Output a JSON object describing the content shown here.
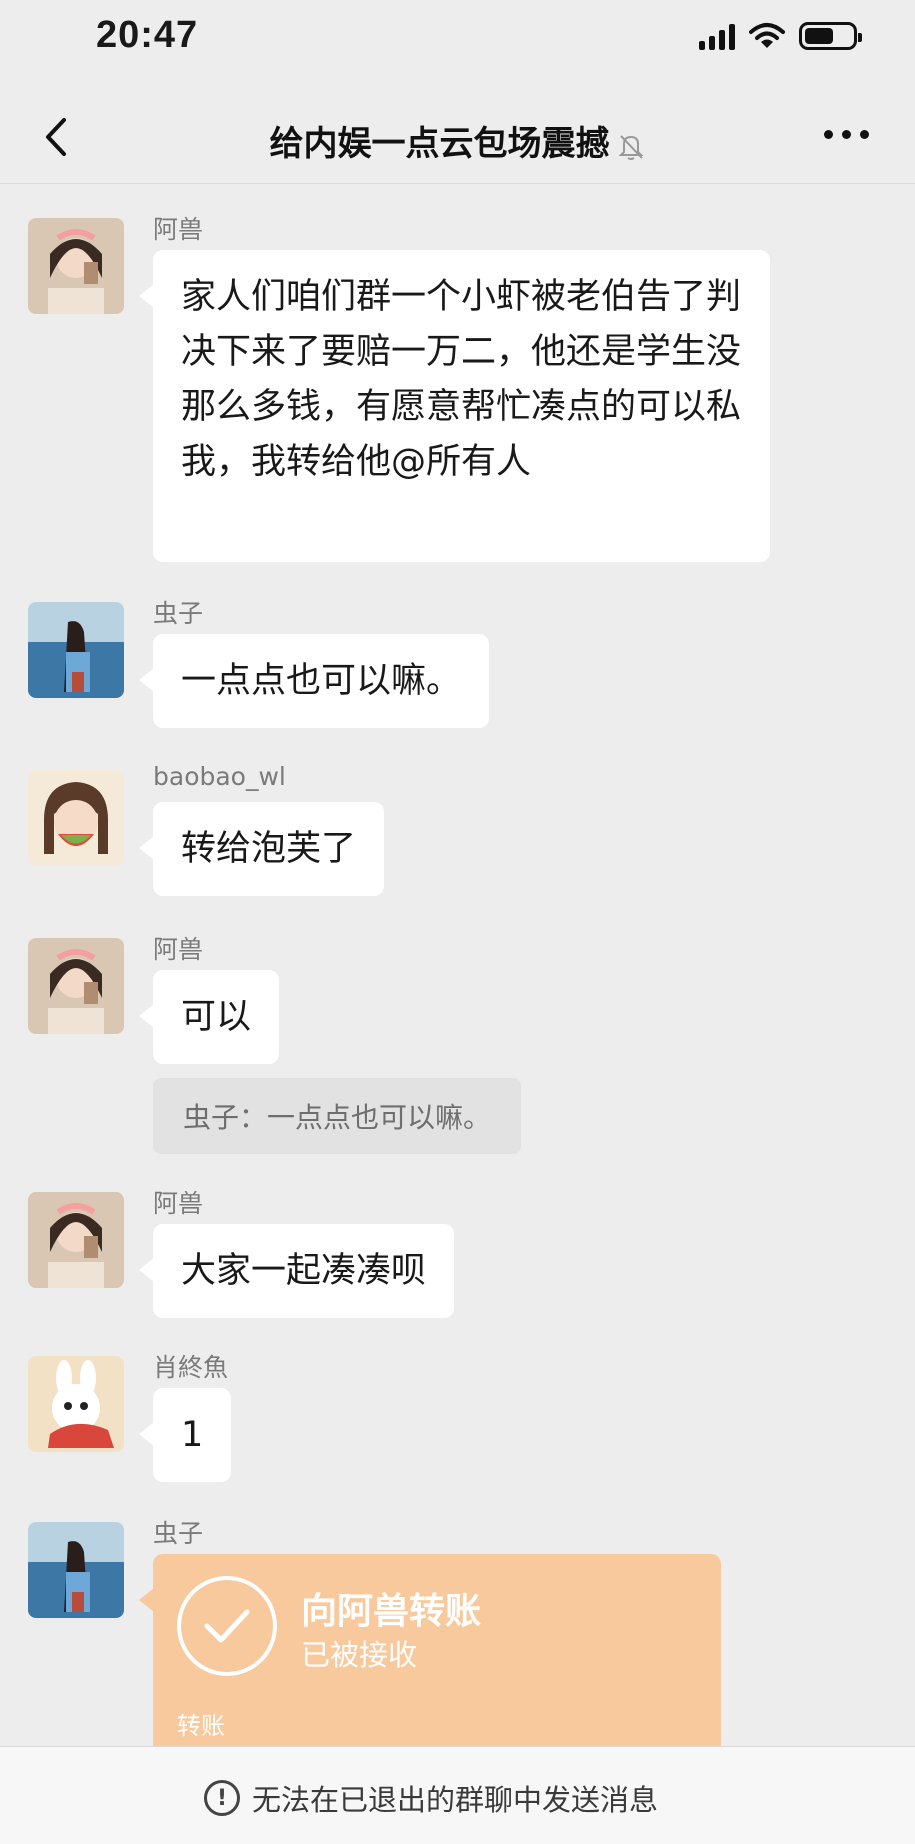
{
  "status": {
    "time": "20:47"
  },
  "header": {
    "title": "给内娱一点云包场震撼",
    "mute_icon": "bell-off-icon",
    "back_icon": "chevron-left-icon",
    "more_icon": "ellipsis-icon"
  },
  "messages": [
    {
      "sender": "阿兽",
      "text": "家人们咱们群一个小虾被老伯告了判决下来了要赔一万二，他还是学生没那么多钱，有愿意帮忙凑点的可以私我，我转给他@所有人"
    },
    {
      "sender": "虫子",
      "text": "一点点也可以嘛。"
    },
    {
      "sender": "baobao_wl",
      "text": "转给泡芙了"
    },
    {
      "sender": "阿兽",
      "text": "可以",
      "quote": "虫子：一点点也可以嘛。"
    },
    {
      "sender": "阿兽",
      "text": "大家一起凑凑呗"
    },
    {
      "sender": "肖終魚",
      "text": "1"
    },
    {
      "sender": "虫子",
      "transfer": {
        "title": "向阿兽转账",
        "status": "已被接收",
        "footer": "转账"
      }
    }
  ],
  "bottom": {
    "notice": "无法在已退出的群聊中发送消息"
  },
  "colors": {
    "background": "#ededed",
    "bubble": "#ffffff",
    "transfer": "#f8c99c"
  }
}
